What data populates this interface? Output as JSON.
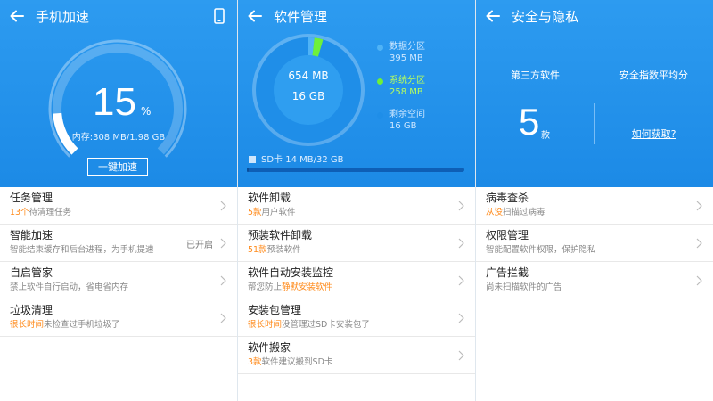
{
  "panel1": {
    "title": "手机加速",
    "gauge": {
      "percent_text": "15",
      "percent_sign": "%",
      "percent_value": 15
    },
    "memory_text": "内存:308 MB/1.98 GB",
    "boost_label": "一键加速",
    "items": [
      {
        "title": "任务管理",
        "sub_hl": "13个",
        "sub_rest": "待清理任务",
        "status": ""
      },
      {
        "title": "智能加速",
        "sub_hl": "",
        "sub_rest": "智能结束缓存和后台进程，为手机提速",
        "status": "已开启"
      },
      {
        "title": "自启管家",
        "sub_hl": "",
        "sub_rest": "禁止软件自行启动，省电省内存",
        "status": ""
      },
      {
        "title": "垃圾清理",
        "sub_hl": "很长时间",
        "sub_rest": "未检查过手机垃圾了",
        "status": ""
      }
    ]
  },
  "panel2": {
    "title": "软件管理",
    "pie": {
      "line1": "654 MB",
      "line2": "16 GB"
    },
    "legend": [
      {
        "name": "数据分区",
        "value": "395 MB",
        "color": "#4fb3f6",
        "text_color": "#cfe8ff"
      },
      {
        "name": "系统分区",
        "value": "258 MB",
        "color": "#6ef03a",
        "text_color": "#b8ff5c"
      },
      {
        "name": "剩余空间",
        "value": "16 GB",
        "color": "#1f8ee8",
        "text_color": "#cfe8ff"
      }
    ],
    "sd_text": "SD卡 14 MB/32 GB",
    "items": [
      {
        "title": "软件卸载",
        "sub_hl": "5款",
        "sub_rest": "用户软件",
        "sub_hl2": ""
      },
      {
        "title": "预装软件卸载",
        "sub_hl": "51款",
        "sub_rest": "预装软件",
        "sub_hl2": ""
      },
      {
        "title": "软件自动安装监控",
        "sub_hl": "",
        "sub_rest": "帮您防止",
        "sub_hl2": "静默安装软件"
      },
      {
        "title": "安装包管理",
        "sub_hl": "很长时间",
        "sub_rest": "没管理过SD卡安装包了",
        "sub_hl2": ""
      },
      {
        "title": "软件搬家",
        "sub_hl": "3款",
        "sub_rest": "软件建议搬到SD卡",
        "sub_hl2": ""
      }
    ]
  },
  "panel3": {
    "title": "安全与隐私",
    "stat_left_label": "第三方软件",
    "stat_right_label": "安全指数平均分",
    "stat_number": "5",
    "stat_unit": "款",
    "howto_link": "如何获取?",
    "items": [
      {
        "title": "病毒查杀",
        "sub_hl": "从没",
        "sub_rest": "扫描过病毒"
      },
      {
        "title": "权限管理",
        "sub_hl": "",
        "sub_rest": "智能配置软件权限，保护隐私"
      },
      {
        "title": "广告拦截",
        "sub_hl": "",
        "sub_rest": "尚未扫描软件的广告"
      }
    ]
  },
  "colors": {
    "hero": "#1c8ae6",
    "highlight": "#ff8a1a",
    "accent_green": "#6ef03a"
  }
}
